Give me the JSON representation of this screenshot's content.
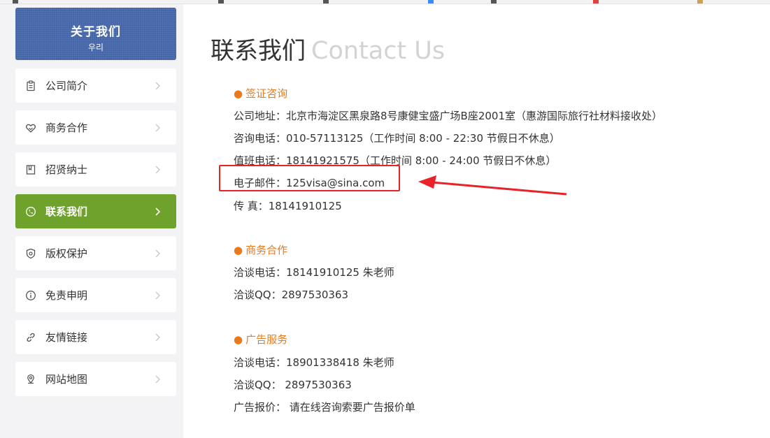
{
  "sidebar": {
    "header_title": "关于我们",
    "header_sub": "우리",
    "items": [
      {
        "label": "公司简介",
        "icon": "clipboard-icon"
      },
      {
        "label": "商务合作",
        "icon": "handshake-icon"
      },
      {
        "label": "招贤纳士",
        "icon": "bookmark-icon"
      },
      {
        "label": "联系我们",
        "icon": "phone-icon",
        "active": true
      },
      {
        "label": "版权保护",
        "icon": "shield-icon"
      },
      {
        "label": "免责申明",
        "icon": "info-icon"
      },
      {
        "label": "友情链接",
        "icon": "link-icon"
      },
      {
        "label": "网站地图",
        "icon": "map-pin-icon"
      }
    ]
  },
  "main": {
    "title_cn": "联系我们",
    "title_en": "Contact Us",
    "sections": [
      {
        "heading": "签证咨询",
        "lines": [
          "公司地址：北京市海淀区黑泉路8号康健宝盛广场B座2001室（惠游国际旅行社材料接收处）",
          "咨询电话：010-57113125（工作时间 8:00 - 22:30 节假日不休息）",
          "值班电话：18141921575（工作时间 8:00 - 24:00 节假日不休息）",
          "电子邮件：125visa@sina.com",
          "传 真：18141910125"
        ]
      },
      {
        "heading": "商务合作",
        "lines": [
          "洽谈电话：18141910125 朱老师",
          "洽谈QQ：2897530363"
        ]
      },
      {
        "heading": "广告服务",
        "lines": [
          "洽谈电话：18901338418 朱老师",
          "洽谈QQ：   2897530363",
          "广告报价：   请在线咨询索要广告报价单"
        ]
      }
    ],
    "bullet": "●"
  },
  "colors": {
    "header_blue": "#4365a8",
    "active_green": "#6ea22c",
    "section_orange": "#e87a1c",
    "annotation_red": "#e82226"
  }
}
